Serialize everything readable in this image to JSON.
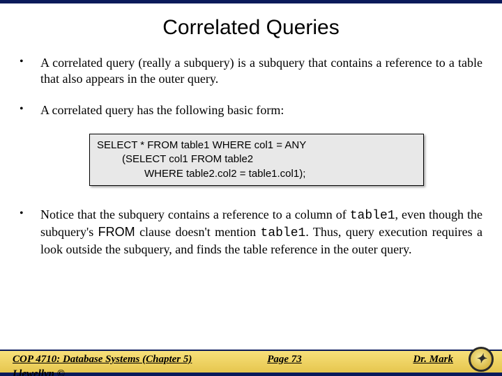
{
  "title": "Correlated Queries",
  "bullets": {
    "b1": "A correlated query (really a subquery) is a subquery that contains a reference to a table that also appears in the outer query.",
    "b2": "A correlated query has the following basic form:",
    "b3_pre": "Notice that the subquery contains a reference to a column of ",
    "b3_t1": "table1",
    "b3_mid1": ", even though the subquery's ",
    "b3_from": "FROM",
    "b3_mid2": " clause doesn't mention ",
    "b3_t2": "table1",
    "b3_post": ". Thus, query execution requires a look outside the subquery, and finds the table reference in the outer query."
  },
  "code": {
    "l1": "SELECT * FROM table1 WHERE col1 = ANY",
    "l2": "(SELECT col1 FROM table2",
    "l3": "WHERE  table2.col2 = table1.col1);"
  },
  "footer": {
    "left": "COP 4710: Database Systems  (Chapter 5)",
    "center": "Page 73",
    "right": "Dr. Mark",
    "overflow": "Llewellyn ©"
  }
}
